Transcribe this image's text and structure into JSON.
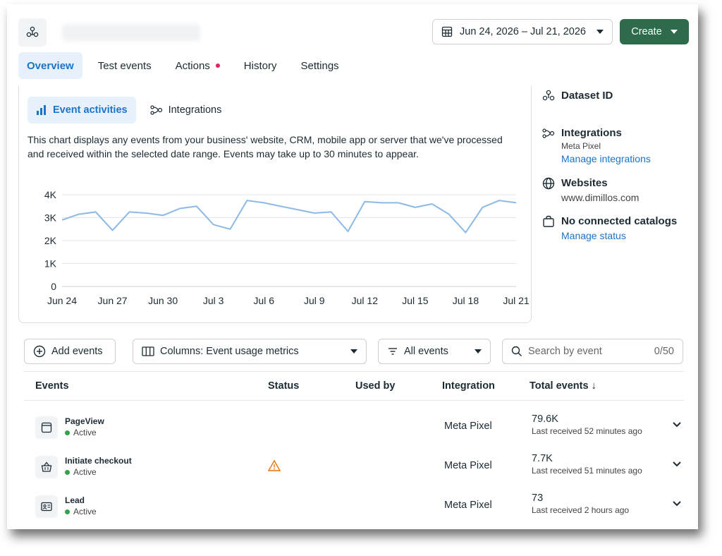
{
  "header": {
    "date_range": "Jun 24, 2026 – Jul 21, 2026",
    "create_label": "Create"
  },
  "tabs": [
    "Overview",
    "Test events",
    "Actions",
    "History",
    "Settings"
  ],
  "chart_tabs": [
    "Event activities",
    "Integrations"
  ],
  "description": "This chart displays any events from your business' website, CRM, mobile app or server that we've processed and received within the selected date range. Events may take up to 30 minutes to appear.",
  "chart_data": {
    "type": "line",
    "x": [
      "Jun 24",
      "Jun 25",
      "Jun 26",
      "Jun 27",
      "Jun 28",
      "Jun 29",
      "Jun 30",
      "Jul 1",
      "Jul 2",
      "Jul 3",
      "Jul 4",
      "Jul 5",
      "Jul 6",
      "Jul 7",
      "Jul 8",
      "Jul 9",
      "Jul 10",
      "Jul 11",
      "Jul 12",
      "Jul 13",
      "Jul 14",
      "Jul 15",
      "Jul 16",
      "Jul 17",
      "Jul 18",
      "Jul 19",
      "Jul 20",
      "Jul 21"
    ],
    "values": [
      2900,
      3150,
      3250,
      2450,
      3250,
      3200,
      3100,
      3400,
      3500,
      2700,
      2500,
      3750,
      3650,
      3500,
      3350,
      3200,
      3250,
      2400,
      3700,
      3650,
      3650,
      3450,
      3600,
      3150,
      2350,
      3450,
      3750,
      3650
    ],
    "x_tick_labels": [
      "Jun 24",
      "Jun 27",
      "Jun 30",
      "Jul 3",
      "Jul 6",
      "Jul 9",
      "Jul 12",
      "Jul 15",
      "Jul 18",
      "Jul 21"
    ],
    "y_tick_labels": [
      "0",
      "1K",
      "2K",
      "3K",
      "4K"
    ],
    "ylim": [
      0,
      4000
    ],
    "grid": true,
    "color": "#8cb9e6"
  },
  "right_panel": {
    "dataset_title": "Dataset ID",
    "integrations_title": "Integrations",
    "integrations_sub": "Meta Pixel",
    "integrations_link": "Manage integrations",
    "websites_title": "Websites",
    "websites_value": "www.dimillos.com",
    "catalogs_title": "No connected catalogs",
    "catalogs_link": "Manage status"
  },
  "toolbar": {
    "add_events": "Add events",
    "columns": "Columns: Event usage metrics",
    "filter": "All events",
    "search_placeholder": "Search by event",
    "search_count": "0/50"
  },
  "table": {
    "headers": [
      "Events",
      "Status",
      "Used by",
      "Integration",
      "Total events ↓"
    ],
    "rows": [
      {
        "name": "PageView",
        "status": "Active",
        "integration": "Meta Pixel",
        "total": "79.6K",
        "last": "Last received 52 minutes ago",
        "icon": "page-icon",
        "warning": false
      },
      {
        "name": "Initiate checkout",
        "status": "Active",
        "integration": "Meta Pixel",
        "total": "7.7K",
        "last": "Last received 51 minutes ago",
        "icon": "basket-icon",
        "warning": true
      },
      {
        "name": "Lead",
        "status": "Active",
        "integration": "Meta Pixel",
        "total": "73",
        "last": "Last received 2 hours ago",
        "icon": "id-card-icon",
        "warning": false
      }
    ]
  },
  "colors": {
    "accent": "#1b74c8",
    "create_bg": "#2d6b4a",
    "active_green": "#31a24c",
    "warning": "#e8710a"
  }
}
